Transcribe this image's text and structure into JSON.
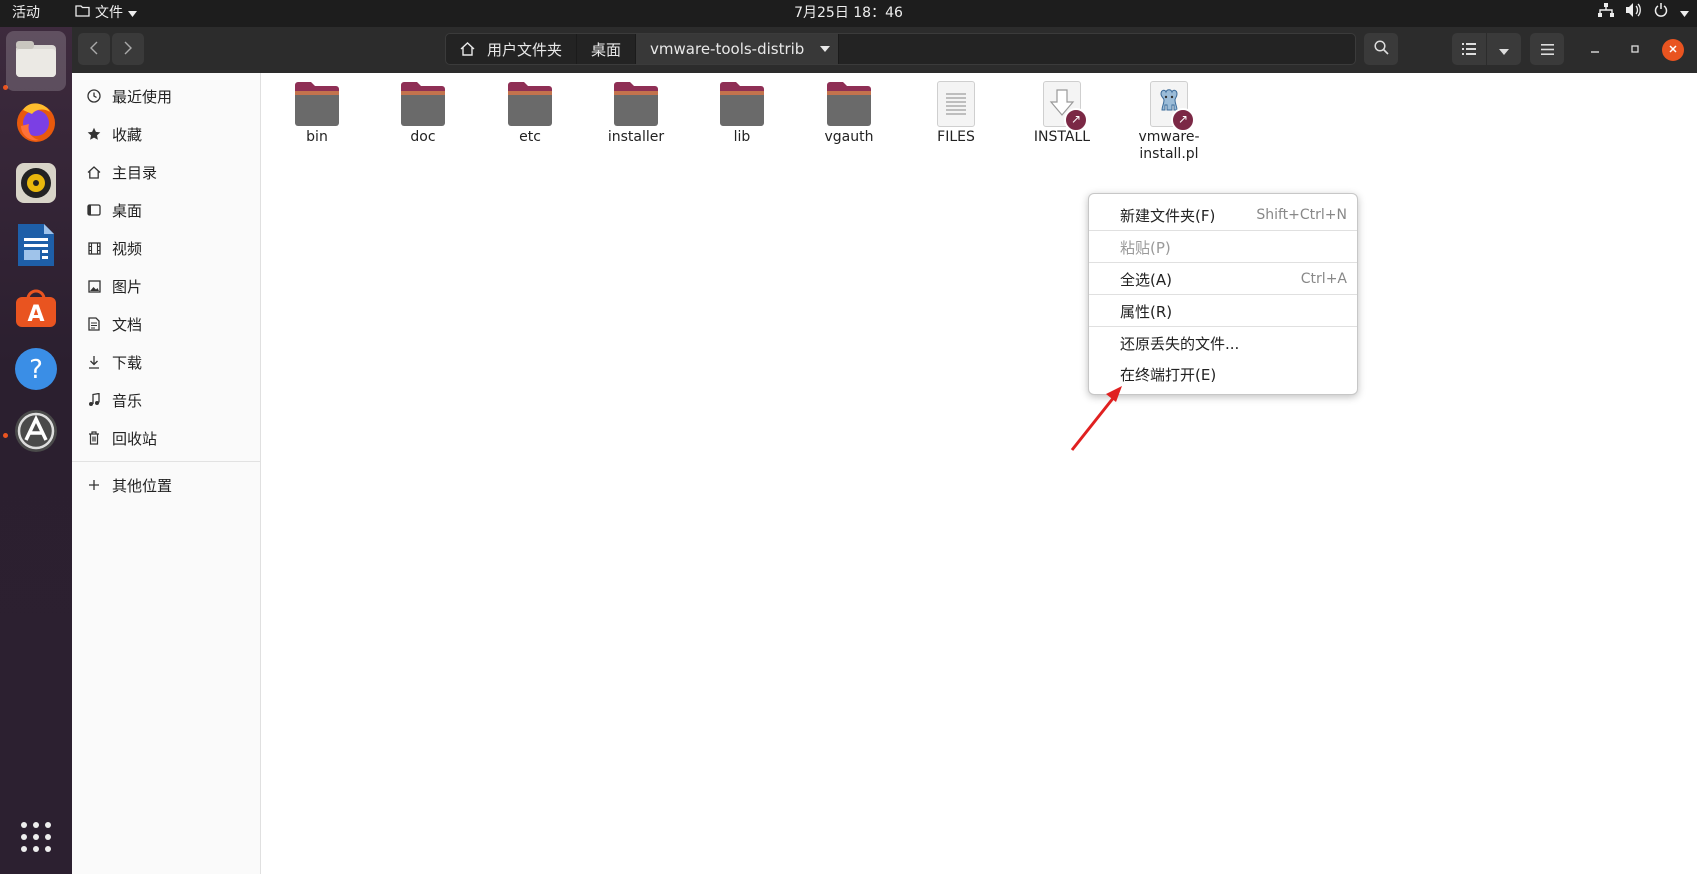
{
  "topbar": {
    "activities": "活动",
    "app_menu": "文件",
    "clock": "7月25日 18：46"
  },
  "dock": {
    "apps": [
      {
        "icon": "files-icon",
        "active": true,
        "running": true
      },
      {
        "icon": "firefox-icon"
      },
      {
        "icon": "rhythmbox-icon"
      },
      {
        "icon": "libreoffice-writer-icon"
      },
      {
        "icon": "ubuntu-software-icon"
      },
      {
        "icon": "help-icon"
      },
      {
        "icon": "software-updater-icon",
        "running": true
      }
    ],
    "show_apps_icon": "app-grid-icon"
  },
  "header": {
    "path": [
      "用户文件夹",
      "桌面",
      "vmware-tools-distrib"
    ]
  },
  "sidebar": {
    "items": [
      {
        "label": "最近使用",
        "icon": "clock-icon"
      },
      {
        "label": "收藏",
        "icon": "star-icon"
      },
      {
        "label": "主目录",
        "icon": "home-icon"
      },
      {
        "label": "桌面",
        "icon": "desktop-icon"
      },
      {
        "label": "视频",
        "icon": "video-icon"
      },
      {
        "label": "图片",
        "icon": "picture-icon"
      },
      {
        "label": "文档",
        "icon": "document-icon"
      },
      {
        "label": "下载",
        "icon": "download-icon"
      },
      {
        "label": "音乐",
        "icon": "music-icon"
      },
      {
        "label": "回收站",
        "icon": "trash-icon"
      }
    ],
    "other_locations": "其他位置"
  },
  "files": [
    {
      "name": "bin",
      "type": "folder"
    },
    {
      "name": "doc",
      "type": "folder"
    },
    {
      "name": "etc",
      "type": "folder"
    },
    {
      "name": "installer",
      "type": "folder"
    },
    {
      "name": "lib",
      "type": "folder"
    },
    {
      "name": "vgauth",
      "type": "folder"
    },
    {
      "name": "FILES",
      "type": "text"
    },
    {
      "name": "INSTALL",
      "type": "link"
    },
    {
      "name_line1": "vmware-",
      "name_line2": "install.pl",
      "type": "perl-link"
    }
  ],
  "context_menu": {
    "items": [
      {
        "label": "新建文件夹(F)",
        "accel": "Shift+Ctrl+N"
      },
      {
        "label": "粘贴(P)",
        "disabled": true
      },
      {
        "label": "全选(A)",
        "accel": "Ctrl+A"
      },
      {
        "label": "属性(R)"
      },
      {
        "label": "还原丢失的文件..."
      },
      {
        "label": "在终端打开(E)"
      }
    ]
  },
  "colors": {
    "accent": "#e95420",
    "folder_top": "#8f2f55",
    "folder_body": "#6a6a6a",
    "annotation_arrow": "#e02020",
    "close_button": "#e95420"
  }
}
